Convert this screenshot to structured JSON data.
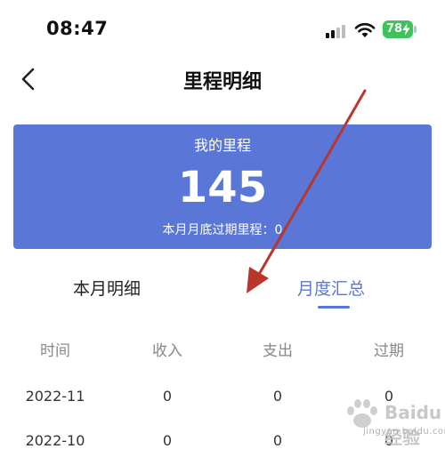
{
  "status_bar": {
    "time": "08:47",
    "battery_level": "78"
  },
  "nav": {
    "title": "里程明细"
  },
  "card": {
    "label": "我的里程",
    "value": "145",
    "expiry_text": "本月月底过期里程：0"
  },
  "tabs": [
    {
      "label": "本月明细",
      "active": false
    },
    {
      "label": "月度汇总",
      "active": true
    }
  ],
  "table": {
    "headers": [
      "时间",
      "收入",
      "支出",
      "过期"
    ],
    "rows": [
      [
        "2022-11",
        "0",
        "0",
        "0"
      ],
      [
        "2022-10",
        "0",
        "0",
        "0"
      ]
    ]
  },
  "watermark": {
    "text": "Baidu 经验",
    "sub": "jingyan.baidu.com"
  },
  "colors": {
    "accent": "#5a77d8",
    "annotation_arrow": "#b8362c",
    "battery": "#3fc25a"
  }
}
